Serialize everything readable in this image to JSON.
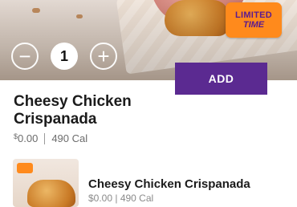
{
  "hero": {
    "badge_line1": "LIMITED",
    "badge_line2": "TIME"
  },
  "quantity": {
    "minus_icon": "minus-icon",
    "value": "1",
    "plus_icon": "plus-icon"
  },
  "actions": {
    "add_label": "ADD"
  },
  "item": {
    "name": "Cheesy Chicken Crispanada",
    "price_currency": "$",
    "price": "0.00",
    "calories": "490 Cal"
  },
  "list": {
    "item_title": "Cheesy Chicken Crispanada",
    "item_subtitle": "$0.00 | 490 Cal"
  },
  "colors": {
    "accent": "#5b2a91",
    "badge": "#ff8a1c"
  }
}
